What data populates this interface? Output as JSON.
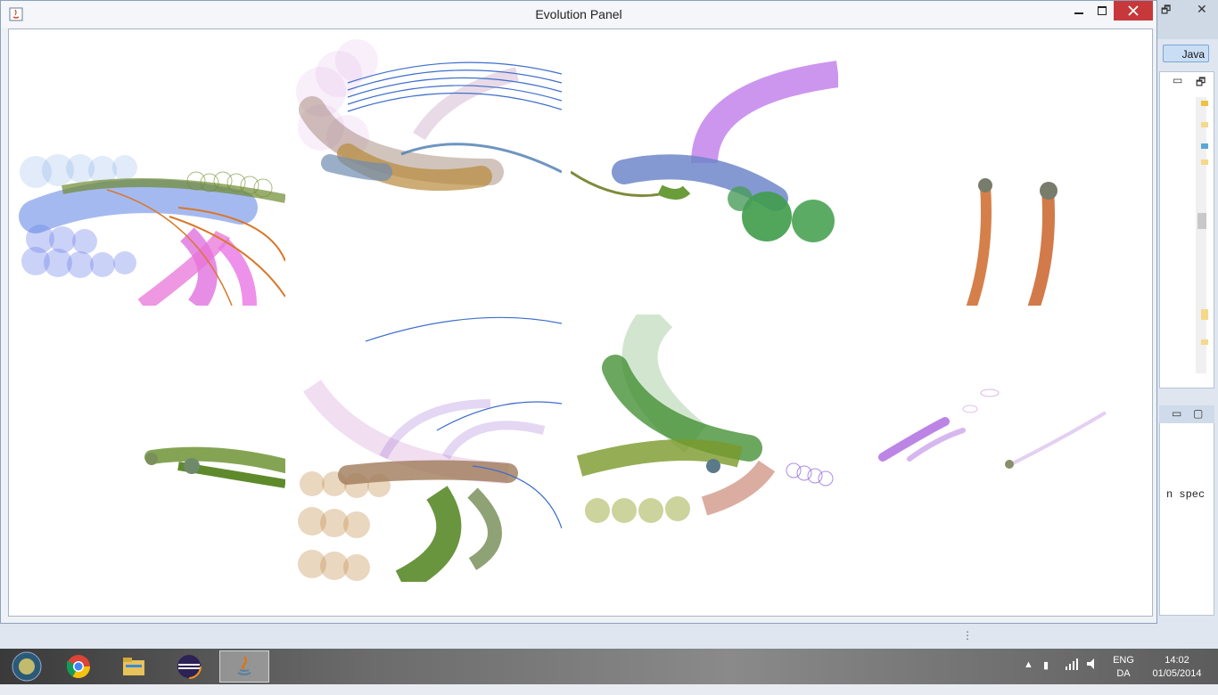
{
  "window": {
    "title": "Evolution Panel"
  },
  "background_ide": {
    "perspective_button": "Java",
    "code_fragment": "n spec"
  },
  "taskbar": {
    "items": [
      "start-button",
      "chrome",
      "file-explorer",
      "eclipse",
      "java"
    ],
    "language": {
      "line1": "ENG",
      "line2": "DA"
    },
    "clock": {
      "time": "14:02",
      "date": "01/05/2014"
    }
  },
  "colors": {
    "close_button": "#c7383b",
    "window_border": "#8aa0bb",
    "canvas": "#ffffff"
  }
}
